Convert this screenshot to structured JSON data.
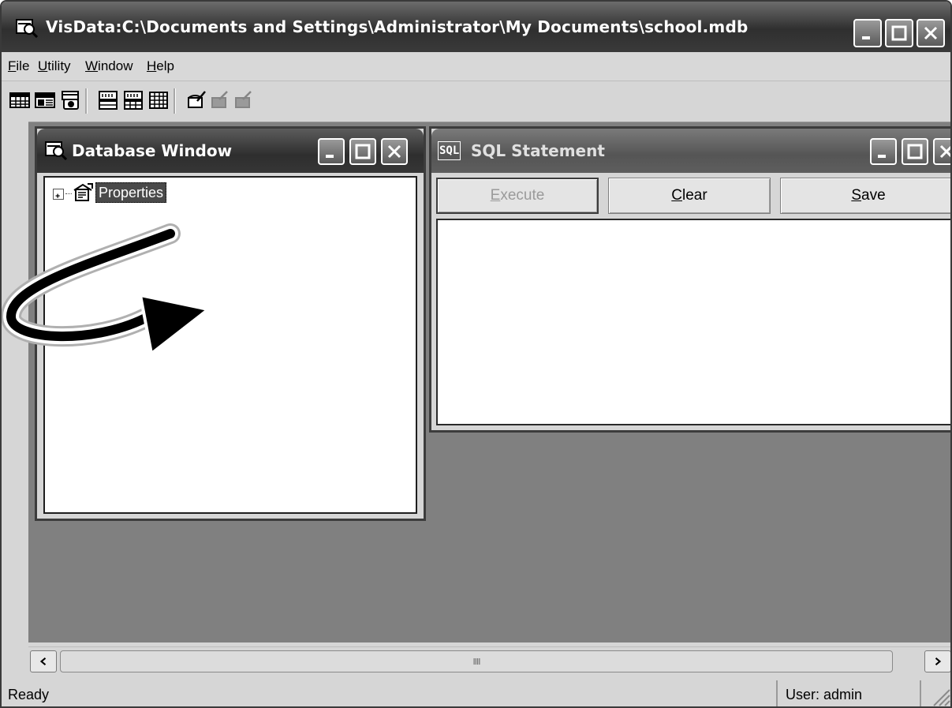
{
  "window": {
    "title": "VisData:C:\\Documents and Settings\\Administrator\\My Documents\\school.mdb"
  },
  "menu": {
    "items": [
      {
        "label": "File"
      },
      {
        "label": "Utility"
      },
      {
        "label": "Window"
      },
      {
        "label": "Help"
      }
    ]
  },
  "toolbar": {
    "icons": [
      "table-icon",
      "dynaset-icon",
      "snapshot-icon",
      "data-control-icon",
      "dbgrid-icon",
      "grid-icon",
      "begin-transaction-icon",
      "commit-icon",
      "rollback-icon"
    ]
  },
  "database_window": {
    "title": "Database Window",
    "tree": {
      "expander": "⊞",
      "root_label": "Properties"
    }
  },
  "sql_window": {
    "title_icon": "SQL",
    "title": "SQL Statement",
    "buttons": {
      "execute": "Execute",
      "clear": "Clear",
      "save": "Save"
    },
    "text": ""
  },
  "status": {
    "left": "Ready",
    "user": "User: admin"
  },
  "scrollbar": {
    "thumb_grip": "IIII"
  },
  "colors": {
    "titlebar": "#2f2f2f",
    "mdi_background": "#808080",
    "face": "#d6d6d6"
  }
}
